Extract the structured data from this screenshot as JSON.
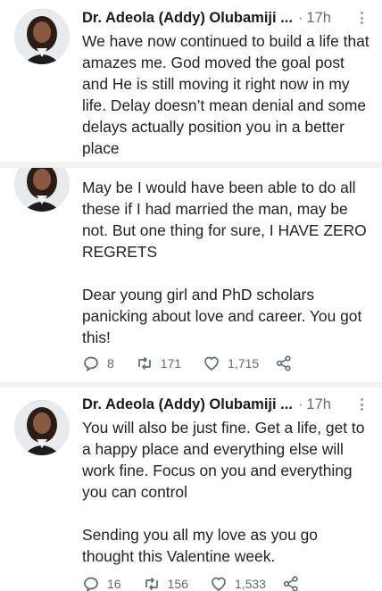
{
  "tweets": [
    {
      "author": "Dr. Adeola (Addy) Olubamiji ...",
      "separator": "·",
      "time": "17h",
      "text": "We have now continued to build a life that amazes me. God moved the goal post and He is still moving it right now in my life. Delay doesn’t mean denial and some delays actually position you in a better place"
    },
    {
      "text": "May be I would have been able to do all these if I had married the man, may be not. But one thing for sure, I HAVE ZERO REGRETS\n\nDear young girl and PhD scholars panicking about love and career. You got this!",
      "replies": "8",
      "retweets": "171",
      "likes": "1,715"
    },
    {
      "author": "Dr. Adeola (Addy) Olubamiji ...",
      "separator": "·",
      "time": "17h",
      "text": "You will also be just fine. Get a life, get to a happy place and everything else will work fine. Focus on you and everything you can control\n\nSending you all my love as you go thought this Valentine week.",
      "replies": "16",
      "retweets": "156",
      "likes": "1,533"
    }
  ],
  "icons": {
    "reply": "reply-icon",
    "retweet": "retweet-icon",
    "like": "heart-icon",
    "share": "share-icon",
    "more": "more-options-icon"
  },
  "colors": {
    "action_gray": "#5c6b78",
    "text": "#222222",
    "meta": "#6b6b6b"
  }
}
